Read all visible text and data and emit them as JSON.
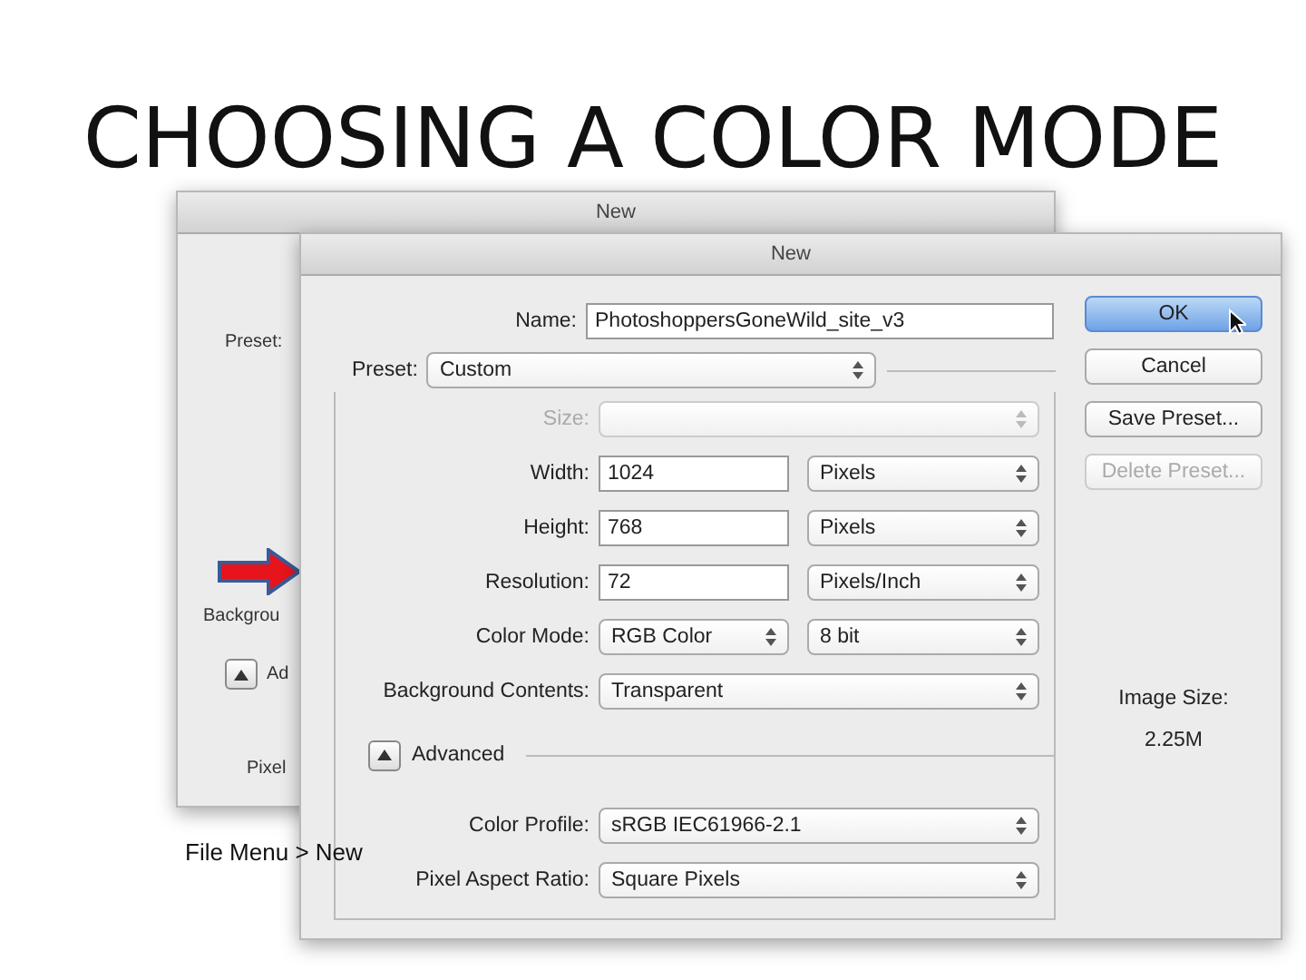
{
  "slide": {
    "title": "CHOOSING A COLOR MODE",
    "caption": "File Menu > New"
  },
  "back_window": {
    "title": "New",
    "preset_label": "Preset:",
    "background_label": "Backgrou",
    "toggle_label": "Ad",
    "pixel_label": "Pixel"
  },
  "dialog": {
    "title": "New",
    "name": {
      "label": "Name:",
      "value": "PhotoshoppersGoneWild_site_v3"
    },
    "preset": {
      "label": "Preset:",
      "value": "Custom"
    },
    "rows": [
      {
        "kind": "select",
        "label": "Size:",
        "disabled": true
      },
      {
        "kind": "input",
        "label": "Width:",
        "value": "1024",
        "unit": "Pixels"
      },
      {
        "kind": "input",
        "label": "Height:",
        "value": "768",
        "unit": "Pixels"
      },
      {
        "kind": "input",
        "label": "Resolution:",
        "value": "72",
        "unit": "Pixels/Inch"
      },
      {
        "kind": "pair",
        "label": "Color Mode:",
        "value": "RGB Color",
        "unit": "8 bit"
      },
      {
        "kind": "select",
        "label": "Background Contents:",
        "value": "Transparent",
        "disabled": false
      }
    ],
    "advanced": {
      "label": "Advanced",
      "expanded": true
    },
    "advanced_rows": [
      {
        "kind": "select",
        "label": "Color Profile:",
        "value": "sRGB IEC61966-2.1",
        "disabled": false
      },
      {
        "kind": "select",
        "label": "Pixel Aspect Ratio:",
        "value": "Square Pixels",
        "disabled": false
      }
    ],
    "buttons": [
      {
        "label": "OK",
        "default": true,
        "disabled": false
      },
      {
        "label": "Cancel",
        "default": false,
        "disabled": false
      },
      {
        "label": "Save Preset...",
        "default": false,
        "disabled": false
      },
      {
        "label": "Delete Preset...",
        "default": false,
        "disabled": true
      }
    ],
    "image_size": {
      "label": "Image Size:",
      "value": "2.25M"
    }
  }
}
